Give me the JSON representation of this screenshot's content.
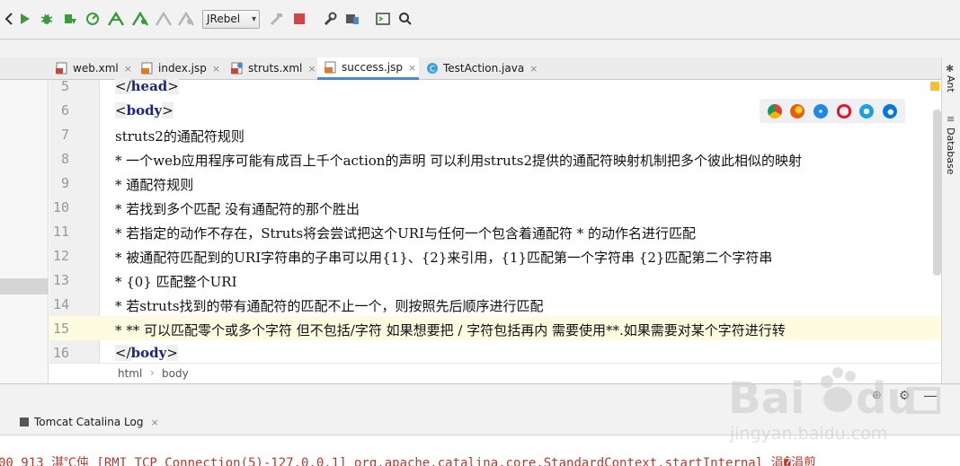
{
  "toolbar": {
    "run_config": "JRebel"
  },
  "tabs": [
    {
      "label": "web.xml",
      "close": "×",
      "icon": "xml-file-icon"
    },
    {
      "label": "index.jsp",
      "close": "×",
      "icon": "jsp-file-icon"
    },
    {
      "label": "struts.xml",
      "close": "×",
      "icon": "struts-file-icon"
    },
    {
      "label": "success.jsp",
      "close": "×",
      "icon": "jsp-file-icon",
      "active": true
    },
    {
      "label": "TestAction.java",
      "close": "×",
      "icon": "java-class-icon"
    }
  ],
  "editor": {
    "lines": [
      {
        "num": "5",
        "parts": [
          {
            "t": "tag_open",
            "v": "</"
          },
          {
            "t": "tag",
            "v": "head"
          },
          {
            "t": "tag_close",
            "v": ">"
          }
        ]
      },
      {
        "num": "6",
        "parts": [
          {
            "t": "tag_open",
            "v": "<"
          },
          {
            "t": "tag",
            "v": "body"
          },
          {
            "t": "tag_close",
            "v": ">"
          }
        ]
      },
      {
        "num": "7",
        "text": "struts2的通配符规则"
      },
      {
        "num": "8",
        "text": "* 一个web应用程序可能有成百上千个action的声明  可以利用struts2提供的通配符映射机制把多个彼此相似的映射"
      },
      {
        "num": "9",
        "text": "* 通配符规则"
      },
      {
        "num": "10",
        "text": "* 若找到多个匹配 没有通配符的那个胜出"
      },
      {
        "num": "11",
        "text": "* 若指定的动作不存在，Struts将会尝试把这个URI与任何一个包含着通配符 * 的动作名进行匹配"
      },
      {
        "num": "12",
        "text": "* 被通配符匹配到的URI字符串的子串可以用{1}、{2}来引用，{1}匹配第一个字符串 {2}匹配第二个字符串"
      },
      {
        "num": "13",
        "text": "* {0} 匹配整个URI"
      },
      {
        "num": "14",
        "text": "* 若struts找到的带有通配符的匹配不止一个，则按照先后顺序进行匹配"
      },
      {
        "num": "15",
        "text": "* ** 可以匹配零个或多个字符 但不包括/字符 如果想要把 / 字符包括再内 需要使用**.如果需要对某个字符进行转"
      },
      {
        "num": "16",
        "parts": [
          {
            "t": "tag_open",
            "v": "</"
          },
          {
            "t": "tag",
            "v": "body"
          },
          {
            "t": "tag_close",
            "v": ">"
          }
        ]
      }
    ]
  },
  "breadcrumb": {
    "items": [
      "html",
      "body"
    ],
    "separator": "›"
  },
  "right_sidebar": {
    "ant": "Ant",
    "database": "Database"
  },
  "bottom_panel": {
    "tab_label": "Tomcat Catalina Log",
    "tab_close": "×",
    "console_text": "00 913 淇℃伅 [RMI TCP Connection(5)-127.0.0.1] org.apache.catalina.core.StandardContext.startInternal 涓�涓煎"
  },
  "colors": {
    "tag": "#1a237e",
    "console_text": "#b33a2e",
    "active_tab_underline": "#4a88c7",
    "current_line": "#fdfbe0"
  }
}
